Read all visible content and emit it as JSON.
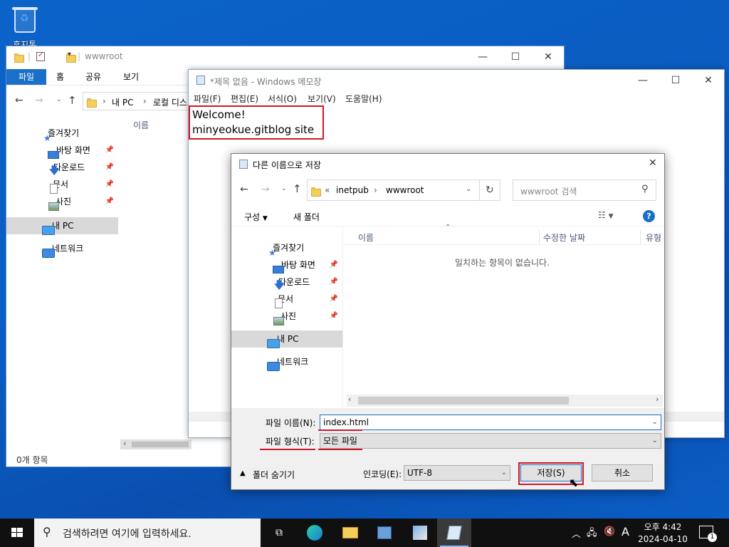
{
  "desktop": {
    "recycle_label": "휴지통"
  },
  "explorer": {
    "title": "wwwroot",
    "ribbon_tabs": [
      "파일",
      "홈",
      "공유",
      "보기"
    ],
    "breadcrumb": [
      "내 PC",
      "로컬 디스크"
    ],
    "column_name": "이름",
    "nav": {
      "quick": "즐겨찾기",
      "desktop": "바탕 화면",
      "downloads": "다운로드",
      "documents": "문서",
      "pictures": "사진",
      "mypc": "내 PC",
      "network": "네트워크"
    },
    "status": "0개 항목"
  },
  "notepad": {
    "title": "*제목 없음 - Windows 메모장",
    "menu": [
      "파일(F)",
      "편집(E)",
      "서식(O)",
      "보기(V)",
      "도움말(H)"
    ],
    "lines": [
      "Welcome!",
      "minyeokue.gitblog site"
    ]
  },
  "save_dialog": {
    "title": "다른 이름으로 저장",
    "path": [
      "inetpub",
      "wwwroot"
    ],
    "path_prefix": "«",
    "search_placeholder": "wwwroot 검색",
    "toolbar": {
      "organize": "구성",
      "new_folder": "새 폴더"
    },
    "columns": [
      "이름",
      "수정한 날짜",
      "유형"
    ],
    "empty_message": "일치하는 항목이 없습니다.",
    "nav": {
      "quick": "즐겨찾기",
      "desktop": "바탕 화면",
      "downloads": "다운로드",
      "documents": "문서",
      "pictures": "사진",
      "mypc": "내 PC",
      "network": "네트워크"
    },
    "filename_label": "파일 이름(N):",
    "filename_value": "index.html",
    "filetype_label": "파일 형식(T):",
    "filetype_value": "모든 파일",
    "hide_folders": "폴더 숨기기",
    "encoding_label": "인코딩(E):",
    "encoding_value": "UTF-8",
    "save_button": "저장(S)",
    "cancel_button": "취소"
  },
  "taskbar": {
    "search_placeholder": "검색하려면 여기에 입력하세요.",
    "ime": "A",
    "time": "오후 4:42",
    "date": "2024-04-10",
    "notification_count": "1"
  },
  "colors": {
    "highlight": "#d0172a",
    "accent": "#1a6fc7",
    "taskbar": "#101010"
  }
}
